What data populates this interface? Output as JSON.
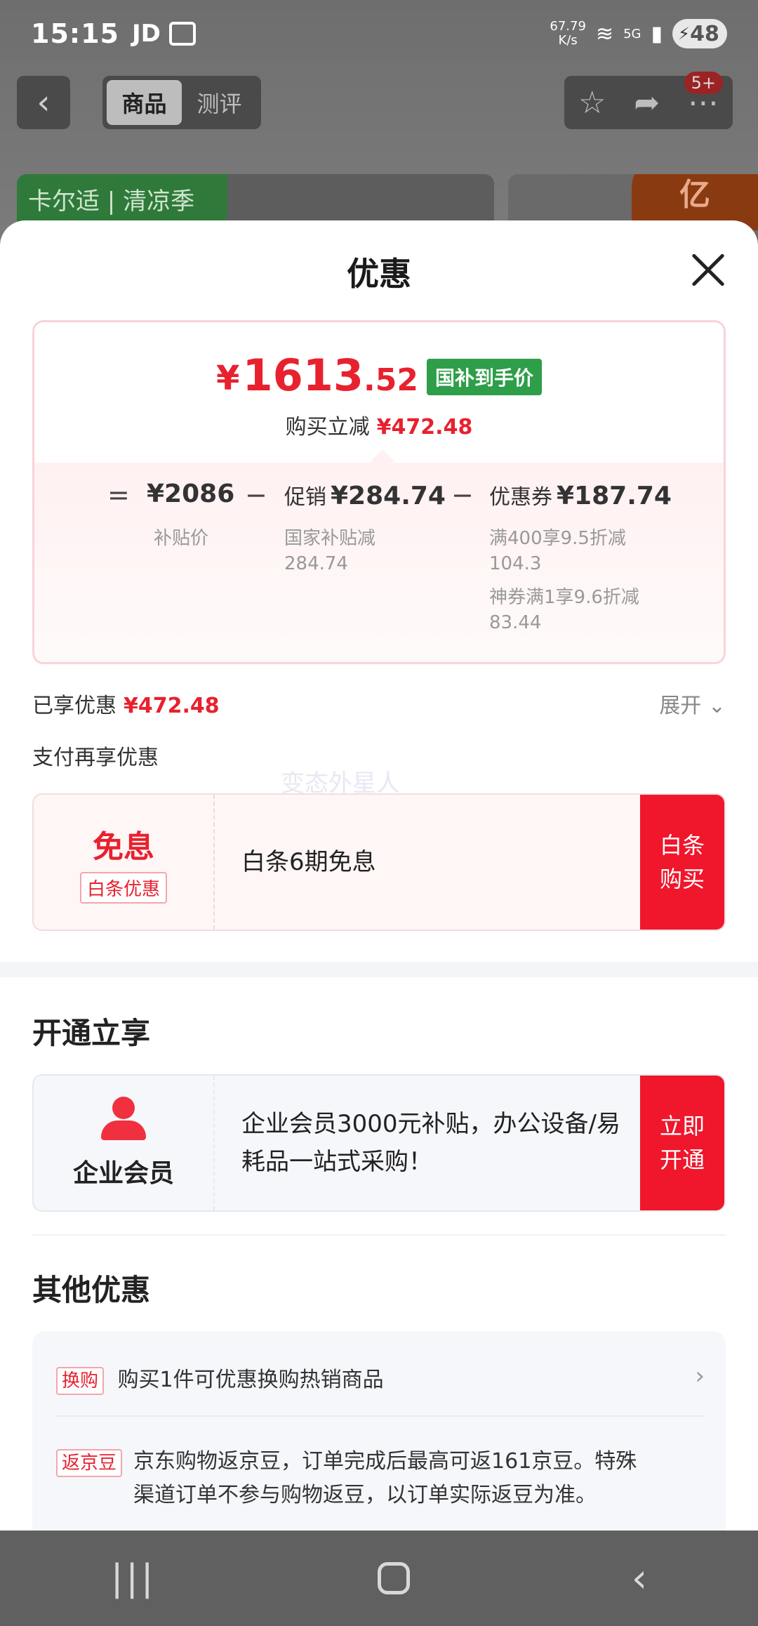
{
  "status_bar": {
    "time": "15:15",
    "carrier": "JD",
    "net_speed_value": "67.79",
    "net_speed_unit": "K/s",
    "network": "5G",
    "battery": "48"
  },
  "top_nav": {
    "tab_goods": "商品",
    "tab_review": "测评",
    "badge": "5+"
  },
  "banner": {
    "brand": "卡尔适 | 清凉季",
    "logo": "亿"
  },
  "sheet": {
    "title": "优惠",
    "price": {
      "currency": "¥",
      "integer": "1613",
      "decimal": ".52",
      "tag": "国补到手价",
      "reduce_label": "购买立减",
      "reduce_amount": "¥472.48"
    },
    "breakdown": {
      "op_equal": "=",
      "op_minus": "−",
      "base_value": "¥2086",
      "base_label": "补贴价",
      "promo_label": "促销",
      "promo_value": "¥284.74",
      "promo_sub1": "国家补贴减",
      "promo_sub2": "284.74",
      "coupon_label": "优惠券",
      "coupon_value": "¥187.74",
      "coupon_sub1": "满400享9.5折减",
      "coupon_sub2": "104.3",
      "coupon_sub3": "神券满1享9.6折减",
      "coupon_sub4": "83.44"
    },
    "enjoyed_label": "已享优惠",
    "enjoyed_amount": "¥472.48",
    "expand_label": "展开",
    "pay_label": "支付再享优惠",
    "watermark": "变态外星人",
    "baitiao": {
      "main": "免息",
      "tag": "白条优惠",
      "text": "白条6期免息",
      "button_line1": "白条",
      "button_line2": "购买"
    },
    "open_section_title": "开通立享",
    "member": {
      "label": "企业会员",
      "text": " 企业会员3000元补贴，办公设备/易耗品一站式采购！",
      "button_line1": "立即",
      "button_line2": "开通"
    },
    "other_title": "其他优惠",
    "other": [
      {
        "tag": "换购",
        "text": "购买1件可优惠换购热销商品"
      },
      {
        "tag": "返京豆",
        "text_line1": "京东购物返京豆，订单完成后最高可返161京豆。特殊",
        "text_line2": "渠道订单不参与购物返豆，以订单实际返豆为准。"
      }
    ]
  },
  "colors": {
    "accent_red": "#e8212f",
    "button_red": "#f0162b",
    "tag_green": "#2e9e49"
  },
  "icons": [
    "back-icon",
    "star-icon",
    "share-icon",
    "more-icon",
    "close-icon",
    "chevron-down-icon",
    "chevron-right-icon",
    "person-icon"
  ]
}
